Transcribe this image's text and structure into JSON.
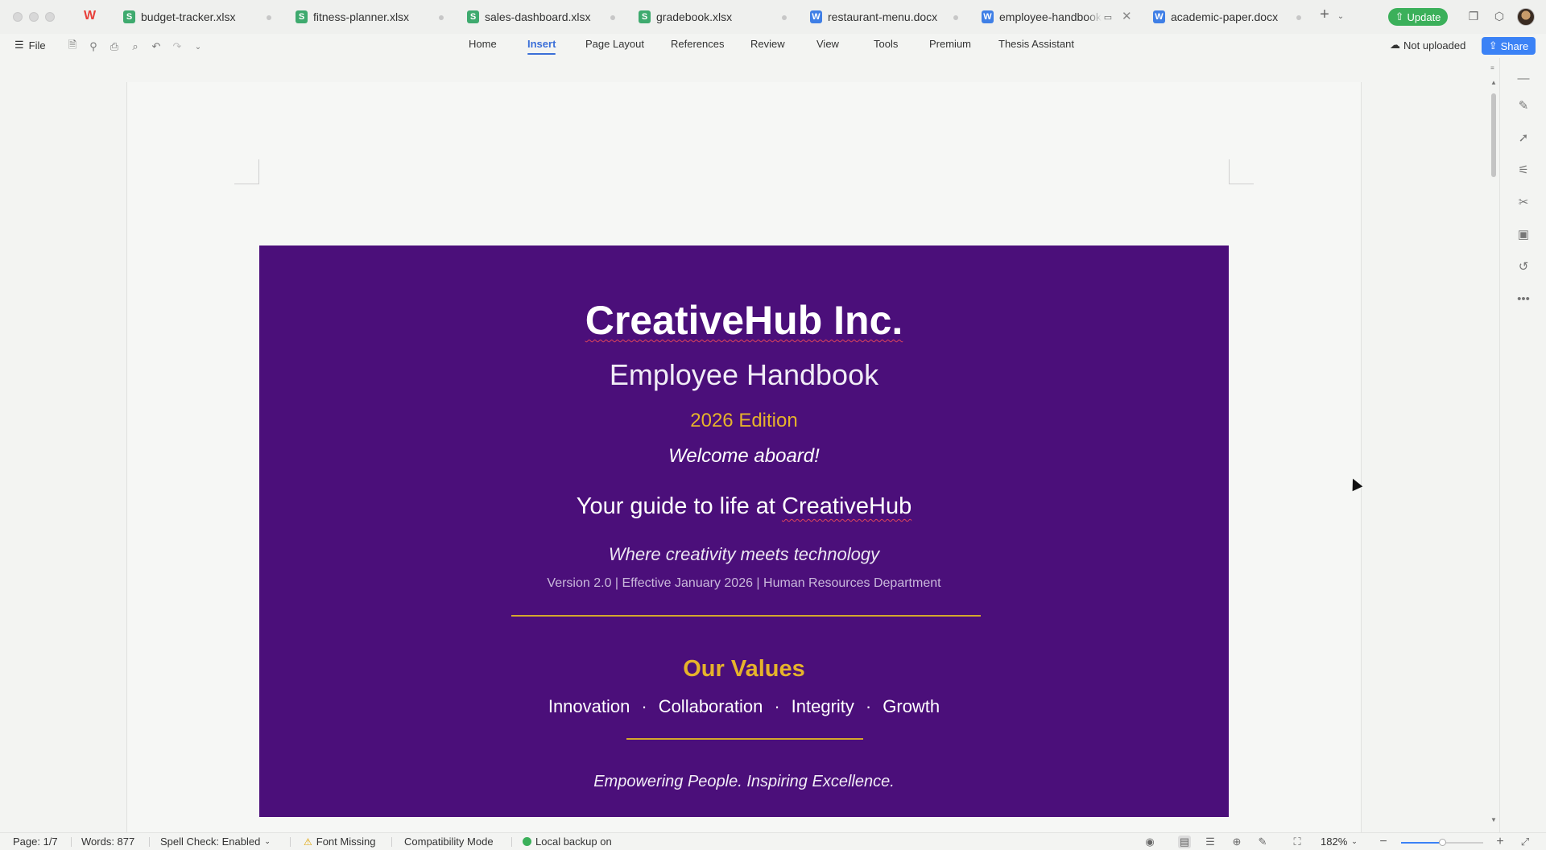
{
  "tabs": [
    {
      "label": "budget-tracker.xlsx",
      "icon": "spreadsheet-icon",
      "type": "S"
    },
    {
      "label": "fitness-planner.xlsx",
      "icon": "spreadsheet-icon",
      "type": "S"
    },
    {
      "label": "sales-dashboard.xlsx",
      "icon": "spreadsheet-icon",
      "type": "S"
    },
    {
      "label": "gradebook.xlsx",
      "icon": "spreadsheet-icon",
      "type": "S"
    },
    {
      "label": "restaurant-menu.docx",
      "icon": "document-icon",
      "type": "W"
    },
    {
      "label": "employee-handbook",
      "icon": "document-icon",
      "type": "W",
      "active": true
    },
    {
      "label": "academic-paper.docx",
      "icon": "document-icon",
      "type": "W"
    }
  ],
  "header": {
    "update_label": "Update",
    "file_label": "File",
    "not_uploaded_label": "Not uploaded",
    "share_label": "Share"
  },
  "menu": {
    "items": [
      "Home",
      "Insert",
      "Page Layout",
      "References",
      "Review",
      "View",
      "Tools",
      "Premium",
      "Thesis Assistant"
    ],
    "active": "Insert"
  },
  "cover": {
    "company": "CreativeHub Inc.",
    "subtitle": "Employee Handbook",
    "edition": "2026 Edition",
    "welcome": "Welcome aboard!",
    "guide_prefix": "Your guide to life at ",
    "guide_brand": "CreativeHub",
    "tagline": "Where creativity meets technology",
    "version": "Version 2.0 | Effective January 2026 | Human Resources Department",
    "values_title": "Our Values",
    "values": [
      "Innovation",
      "Collaboration",
      "Integrity",
      "Growth"
    ],
    "values_separator": "·",
    "motto": "Empowering People. Inspiring Excellence.",
    "background_color": "#4b0f7a",
    "accent_color": "#e6b32b"
  },
  "status": {
    "page": "Page: 1/7",
    "words": "Words: 877",
    "spell_check": "Spell Check: Enabled",
    "font_missing": "Font Missing",
    "compat": "Compatibility Mode",
    "backup": "Local backup on",
    "zoom": "182%",
    "zoom_fraction": 0.5
  },
  "colors": {
    "accent_blue": "#3b82f6",
    "update_green": "#3bb05a"
  }
}
